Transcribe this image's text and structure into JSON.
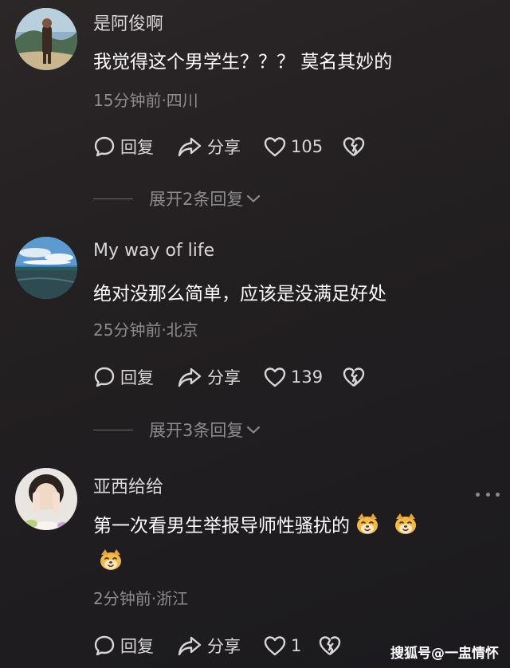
{
  "comments": [
    {
      "username": "是阿俊啊",
      "text": "我觉得这个男学生？？？ 莫名其妙的",
      "meta": "15分钟前·四川",
      "reply_label": "回复",
      "share_label": "分享",
      "like_count": "105",
      "expand_label": "展开2条回复"
    },
    {
      "username": "My way of life",
      "text": "绝对没那么简单，应该是没满足好处",
      "meta": "25分钟前·北京",
      "reply_label": "回复",
      "share_label": "分享",
      "like_count": "139",
      "expand_label": "展开3条回复"
    },
    {
      "username": "亚西给给",
      "text": "第一次看男生举报导师性骚扰的",
      "meta": "2分钟前·浙江",
      "reply_label": "回复",
      "share_label": "分享",
      "like_count": "1"
    }
  ],
  "watermark": "搜狐号@一盅情怀",
  "colors": {
    "background": "#221f21",
    "secondary_text": "#8e8b8d",
    "primary_text": "#ffffff"
  }
}
